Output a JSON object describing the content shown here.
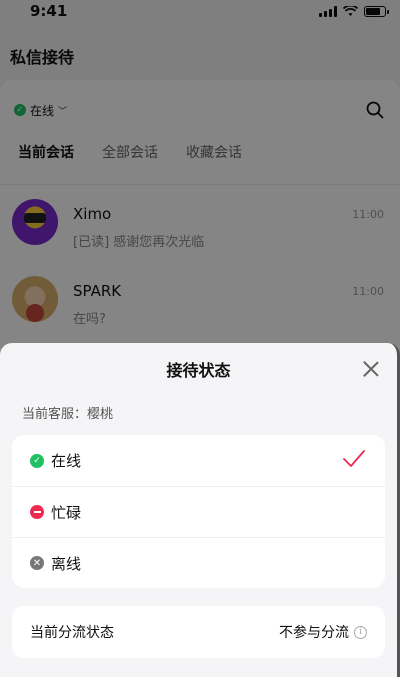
{
  "status_bar": {
    "time": "9:41"
  },
  "page": {
    "title": "私信接待"
  },
  "main": {
    "online_status": "在线",
    "tabs": [
      {
        "label": "当前会话",
        "active": true
      },
      {
        "label": "全部会话",
        "active": false
      },
      {
        "label": "收藏会话",
        "active": false
      }
    ],
    "conversations": [
      {
        "name": "Ximo",
        "time": "11:00",
        "message": "[已读] 感谢您再次光临"
      },
      {
        "name": "SPARK",
        "time": "11:00",
        "message": "在吗?"
      }
    ]
  },
  "sheet": {
    "title": "接待状态",
    "agent_label": "当前客服：樱桃",
    "statuses": [
      {
        "label": "在线",
        "selected": true,
        "color": "#21c063"
      },
      {
        "label": "忙碌",
        "selected": false,
        "color": "#f0294e"
      },
      {
        "label": "离线",
        "selected": false,
        "color": "#777777"
      }
    ],
    "distribution": {
      "label": "当前分流状态",
      "value": "不参与分流"
    }
  },
  "colors": {
    "accent": "#f0294e",
    "online": "#21c063"
  }
}
